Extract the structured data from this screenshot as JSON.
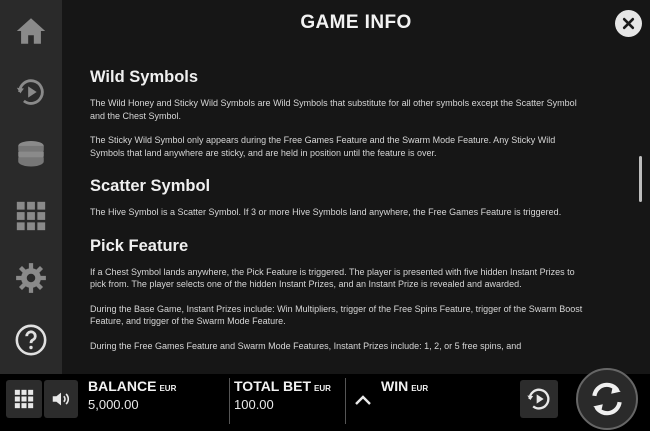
{
  "header": {
    "title": "GAME INFO"
  },
  "sidebar": {
    "items": [
      {
        "icon": "home-icon"
      },
      {
        "icon": "autoplay-icon"
      },
      {
        "icon": "coins-icon"
      },
      {
        "icon": "paytable-grid-icon"
      },
      {
        "icon": "settings-gear-icon"
      },
      {
        "icon": "help-icon"
      }
    ]
  },
  "sections": [
    {
      "heading": "Wild Symbols",
      "paragraphs": [
        "The Wild Honey and Sticky Wild Symbols are Wild Symbols that substitute for all other symbols except the Scatter Symbol and the Chest Symbol.",
        "The Sticky Wild Symbol only appears during the Free Games Feature and the Swarm Mode Feature. Any Sticky Wild Symbols that land anywhere are sticky, and are held in position until the feature is over."
      ]
    },
    {
      "heading": "Scatter Symbol",
      "paragraphs": [
        "The Hive Symbol is a Scatter Symbol. If 3 or more Hive Symbols land anywhere, the Free Games Feature is triggered."
      ]
    },
    {
      "heading": "Pick Feature",
      "paragraphs": [
        "If a Chest Symbol lands anywhere, the Pick Feature is triggered. The player is presented with five hidden Instant Prizes to pick from. The player selects one of the hidden Instant Prizes, and an Instant Prize is revealed and awarded.",
        "During the Base Game, Instant Prizes include: Win Multipliers, trigger of the Free Spins Feature, trigger of the Swarm Boost Feature, and trigger of the Swarm Mode Feature.",
        "During the Free Games Feature and Swarm Mode Features, Instant Prizes include: 1, 2, or 5 free spins, and"
      ]
    }
  ],
  "footer": {
    "balance": {
      "label": "BALANCE",
      "currency": "EUR",
      "value": "5,000.00"
    },
    "total_bet": {
      "label": "TOTAL BET",
      "currency": "EUR",
      "value": "100.00"
    },
    "win": {
      "label": "WIN",
      "currency": "EUR",
      "value": ""
    }
  },
  "colors": {
    "panel": "#161616",
    "sidebar": "#2a2a2a",
    "text": "#e8e8e8",
    "bar": "#000000"
  }
}
